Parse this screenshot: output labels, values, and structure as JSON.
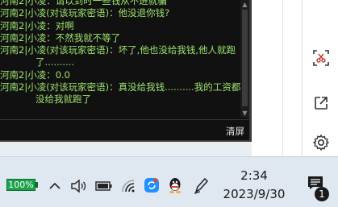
{
  "chat": {
    "lines": [
      {
        "text": "河南2|小凌：请以到时一些钱从不进就骗",
        "wrap": false
      },
      {
        "text": "河南2|小凌(对该玩家密语)：他没退你钱?",
        "wrap": false
      },
      {
        "text": "河南2|小凌：对啊",
        "wrap": false
      },
      {
        "text": "河南2|小凌：不然我就不等了",
        "wrap": false
      },
      {
        "text": "河南2|小凌(对该玩家密语)：坏了,他也没给我钱,他人就跑",
        "wrap": false
      },
      {
        "text": "了..........",
        "wrap": true
      },
      {
        "text": "河南2|小凌：0.0",
        "wrap": false
      },
      {
        "text": "河南2|小凌(对该玩家密语)：真没给我钱..........我的工资都",
        "wrap": false
      },
      {
        "text": "没给我就跑了",
        "wrap": true
      }
    ],
    "clear_label": "清屏"
  },
  "taskbar": {
    "battery_label": "100%",
    "time": "2:34",
    "date": "2023/9/30",
    "notification_count": "1"
  },
  "colors": {
    "chat_text": "#9de56e",
    "chat_bg": "#111111",
    "battery": "#1aa34a"
  },
  "icons": {
    "sidebar": [
      "screenshot-icon",
      "open-external-icon",
      "settings-icon"
    ],
    "tray": [
      "chevron-up-icon",
      "speaker-icon",
      "battery-plugged-icon",
      "wifi-icon",
      "sync-app-icon",
      "qq-icon",
      "pen-icon",
      "notification-icon"
    ]
  }
}
